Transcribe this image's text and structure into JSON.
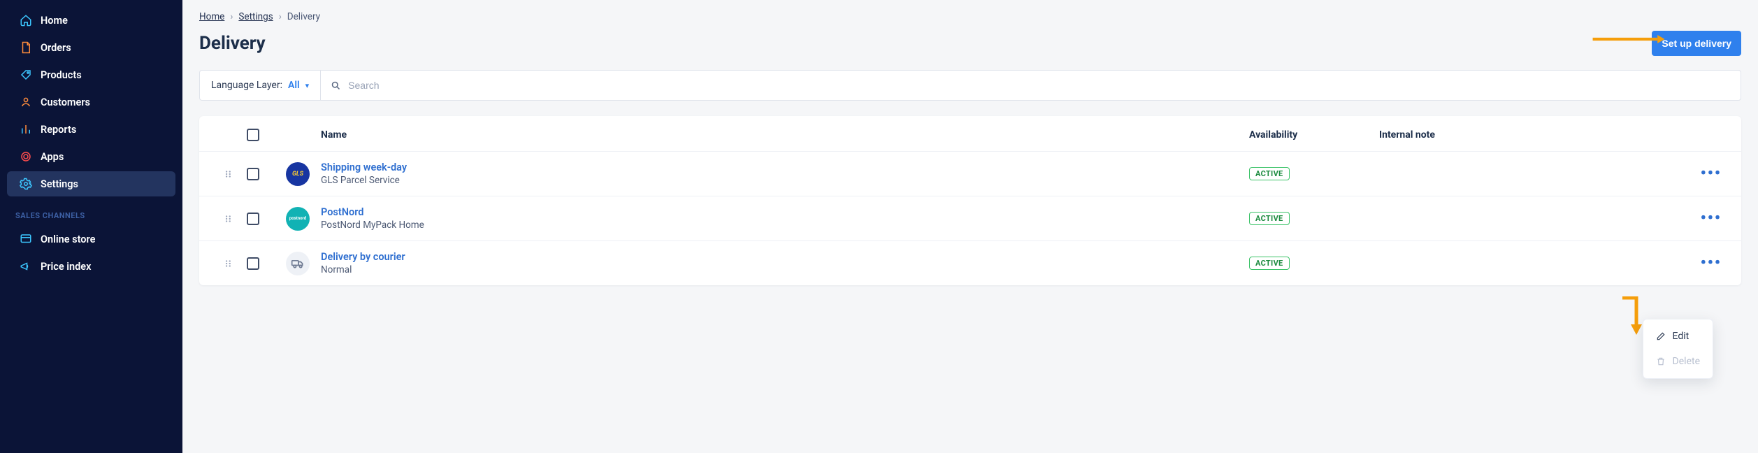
{
  "sidebar": {
    "items": [
      {
        "label": "Home"
      },
      {
        "label": "Orders"
      },
      {
        "label": "Products"
      },
      {
        "label": "Customers"
      },
      {
        "label": "Reports"
      },
      {
        "label": "Apps"
      },
      {
        "label": "Settings"
      }
    ],
    "section_label": "SALES CHANNELS",
    "channels": [
      {
        "label": "Online store"
      },
      {
        "label": "Price index"
      }
    ]
  },
  "breadcrumb": {
    "items": [
      "Home",
      "Settings",
      "Delivery"
    ]
  },
  "page": {
    "title": "Delivery",
    "setup_button": "Set up delivery"
  },
  "filter": {
    "lang_label": "Language Layer:",
    "lang_value": "All",
    "search_placeholder": "Search"
  },
  "table": {
    "columns": {
      "name": "Name",
      "availability": "Availability",
      "note": "Internal note"
    },
    "rows": [
      {
        "title": "Shipping week-day",
        "subtitle": "GLS Parcel Service",
        "status": "ACTIVE",
        "logo": {
          "bg": "#1735a1",
          "text": "GLS"
        },
        "note": ""
      },
      {
        "title": "PostNord",
        "subtitle": "PostNord MyPack Home",
        "status": "ACTIVE",
        "logo": {
          "bg": "#11b2b4",
          "text": "postnord"
        },
        "note": ""
      },
      {
        "title": "Delivery by courier",
        "subtitle": "Normal",
        "status": "ACTIVE",
        "logo": {
          "bg": "#eef1f6",
          "text": "truck"
        },
        "note": ""
      }
    ]
  },
  "dropdown": {
    "edit": "Edit",
    "delete": "Delete"
  }
}
